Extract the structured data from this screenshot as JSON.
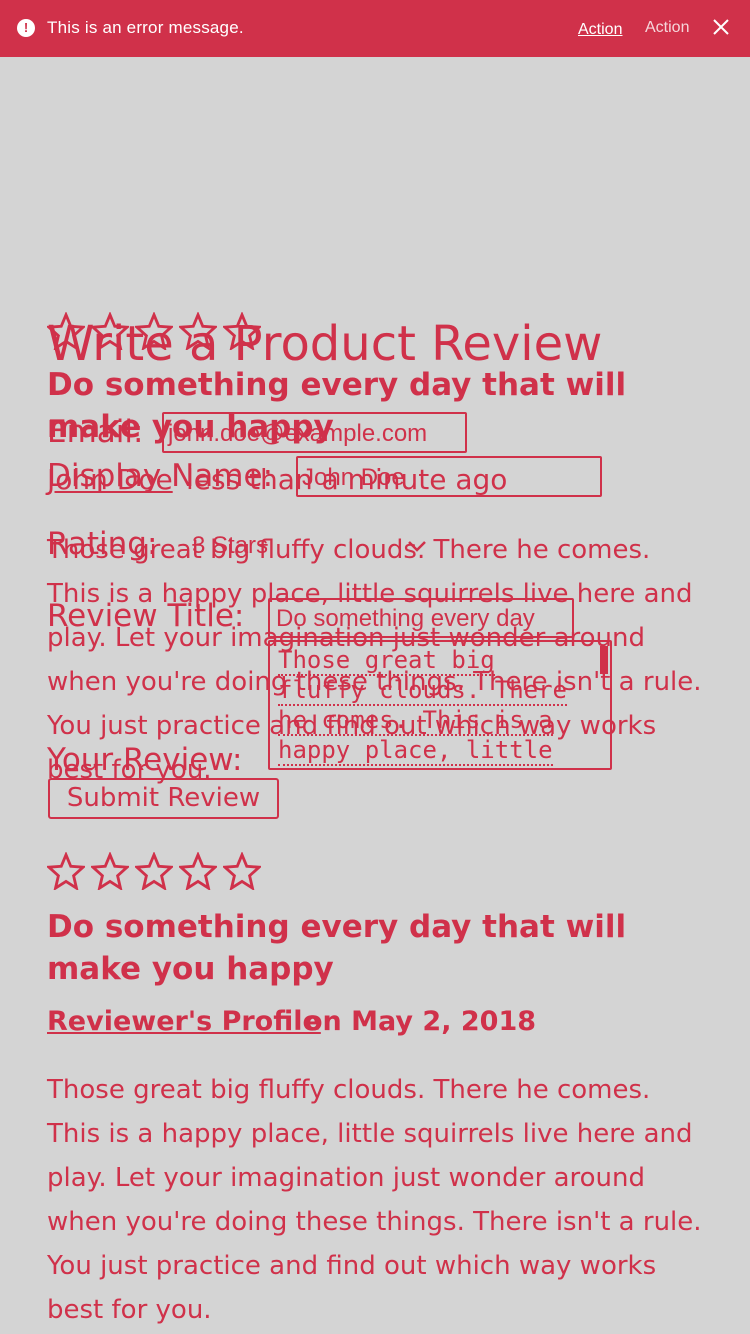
{
  "banner": {
    "message": "This is an error message.",
    "action_1": "Action",
    "action_2": "Action",
    "icon": "alert-icon",
    "close_icon": "close-icon",
    "background": "#d0314a"
  },
  "form": {
    "stars_icon": "star-outline-icon",
    "title": "Write a Product Review",
    "subtitle": "Do something every day that will make you happy",
    "email_label": "Email:",
    "email_value": "john.doe@example.com",
    "display_name_label": "Display Name:",
    "display_name_value": "John Doe",
    "author_link": "John Doe",
    "time_ago": "less than a minute ago",
    "rating_label": "Rating:",
    "rating_value": "3 Stars",
    "review_title_label": "Review Title:",
    "review_title_value": "Do something every day",
    "review_label": "Your Review:",
    "review_value_lines": [
      "Those great big",
      "fluffy clouds. There",
      "he comes. This is a",
      "happy place, little"
    ],
    "overlay_text": "Those great big fluffy clouds. There he comes. This is a happy place, little squirrels live here and play. Let your imagination just wonder around when you're doing these things. There isn't a rule. You just practice and find out which way works best for you.",
    "submit_label": "Submit Review"
  },
  "review": {
    "stars_icon": "star-outline-icon",
    "title": "Do something every day that will make you happy",
    "profile_link": "Reviewer's Profile",
    "date": "on May 2, 2018",
    "body": "Those great big fluffy clouds. There he comes. This is a happy place, little squirrels live here and play. Let your imagination just wonder around when you're doing these things. There isn't a rule. You just practice and find out which way works best for you."
  },
  "colors": {
    "accent": "#d0314a",
    "background": "#d4d4d4"
  }
}
